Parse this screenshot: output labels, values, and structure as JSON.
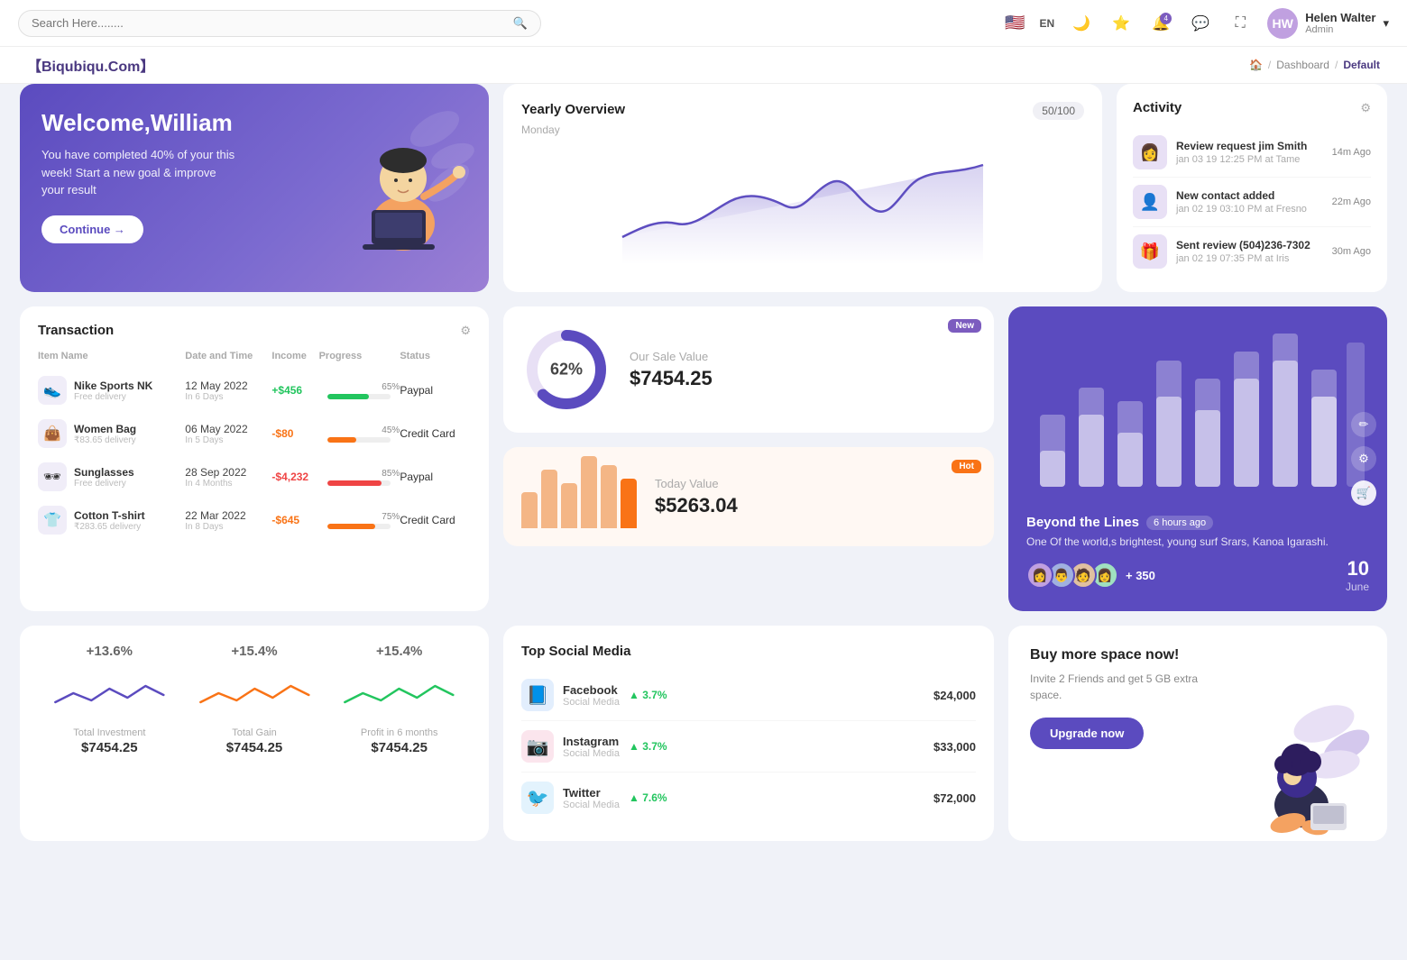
{
  "topnav": {
    "search_placeholder": "Search Here........",
    "lang": "EN",
    "user_name": "Helen Walter",
    "user_role": "Admin",
    "user_initials": "HW",
    "notification_count": "4"
  },
  "breadcrumb": {
    "brand": "【Biqubiqu.Com】",
    "home": "🏠",
    "sep1": "/",
    "item1": "Dashboard",
    "sep2": "/",
    "item2": "Default"
  },
  "welcome": {
    "title": "Welcome,William",
    "subtitle": "You have completed 40% of your this week! Start a new goal & improve your result",
    "btn": "Continue →"
  },
  "yearly": {
    "title": "Yearly Overview",
    "day": "Monday",
    "count": "50/100"
  },
  "activity": {
    "title": "Activity",
    "items": [
      {
        "title": "Review request jim Smith",
        "sub": "jan 03 19 12:25 PM at Tame",
        "time": "14m Ago",
        "emoji": "👩"
      },
      {
        "title": "New contact added",
        "sub": "jan 02 19 03:10 PM at Fresno",
        "time": "22m Ago",
        "emoji": "👤"
      },
      {
        "title": "Sent review (504)236-7302",
        "sub": "jan 02 19 07:35 PM at Iris",
        "time": "30m Ago",
        "emoji": "🎁"
      }
    ]
  },
  "transaction": {
    "title": "Transaction",
    "cols": [
      "Item Name",
      "Date and Time",
      "Income",
      "Progress",
      "Status"
    ],
    "rows": [
      {
        "name": "Nike Sports NK",
        "sub": "Free delivery",
        "date": "12 May 2022",
        "days": "In 6 Days",
        "income": "+$456",
        "income_type": "pos",
        "pct": 65,
        "status": "Paypal",
        "emoji": "👟"
      },
      {
        "name": "Women Bag",
        "sub": "₹83.65 delivery",
        "date": "06 May 2022",
        "days": "In 5 Days",
        "income": "-$80",
        "income_type": "neg",
        "pct": 45,
        "status": "Credit Card",
        "emoji": "👜"
      },
      {
        "name": "Sunglasses",
        "sub": "Free delivery",
        "date": "28 Sep 2022",
        "days": "In 4 Months",
        "income": "-$4,232",
        "income_type": "red",
        "pct": 85,
        "status": "Paypal",
        "emoji": "🕶"
      },
      {
        "name": "Cotton T-shirt",
        "sub": "₹283.65 delivery",
        "date": "22 Mar 2022",
        "days": "In 8 Days",
        "income": "-$645",
        "income_type": "neg",
        "pct": 75,
        "status": "Credit Card",
        "emoji": "👕"
      }
    ]
  },
  "sale_value": {
    "pct": "62%",
    "label": "Our Sale Value",
    "amount": "$7454.25",
    "badge": "New"
  },
  "today_value": {
    "label": "Today Value",
    "amount": "$5263.04",
    "badge": "Hot",
    "bars": [
      40,
      65,
      50,
      80,
      70,
      55
    ]
  },
  "bar_chart": {
    "title": "Beyond the Lines",
    "time": "6 hours ago",
    "desc": "One Of the world,s brightest, young surf Srars, Kanoa Igarashi.",
    "count": "+ 350",
    "date": "10",
    "date_sub": "June",
    "bars": [
      {
        "h1": 60,
        "h2": 100
      },
      {
        "h1": 80,
        "h2": 120
      },
      {
        "h1": 50,
        "h2": 90
      },
      {
        "h1": 100,
        "h2": 150
      },
      {
        "h1": 70,
        "h2": 110
      },
      {
        "h1": 90,
        "h2": 140
      },
      {
        "h1": 60,
        "h2": 160
      },
      {
        "h1": 75,
        "h2": 130
      }
    ]
  },
  "mini_stats": [
    {
      "pct": "+13.6%",
      "label": "Total Investment",
      "value": "$7454.25",
      "color": "#5b4bbf"
    },
    {
      "pct": "+15.4%",
      "label": "Total Gain",
      "value": "$7454.25",
      "color": "#f97316"
    },
    {
      "pct": "+15.4%",
      "label": "Profit in 6 months",
      "value": "$7454.25",
      "color": "#22c55e"
    }
  ],
  "social": {
    "title": "Top Social Media",
    "items": [
      {
        "name": "Facebook",
        "type": "Social Media",
        "pct": "3.7%",
        "amount": "$24,000",
        "color": "#1877f2",
        "emoji": "f"
      },
      {
        "name": "Instagram",
        "type": "Social Media",
        "pct": "3.7%",
        "amount": "$33,000",
        "color": "#e1306c",
        "emoji": "📸"
      },
      {
        "name": "Twitter",
        "type": "Social Media",
        "pct": "7.6%",
        "amount": "$72,000",
        "color": "#1da1f2",
        "emoji": "🐦"
      }
    ]
  },
  "buy_space": {
    "title": "Buy more space now!",
    "desc": "Invite 2 Friends and get 5 GB extra space.",
    "btn": "Upgrade now"
  }
}
